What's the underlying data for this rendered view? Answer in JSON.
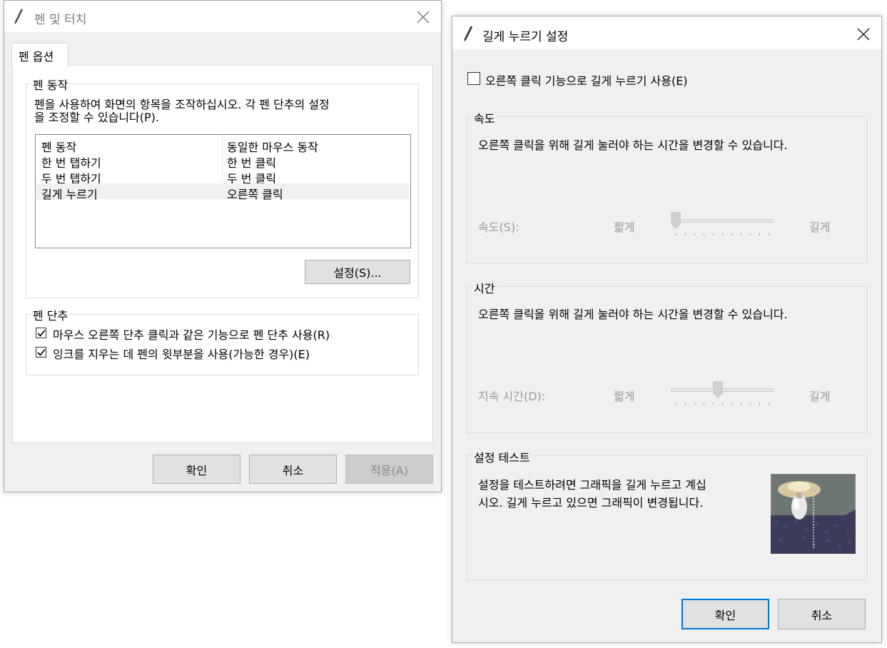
{
  "pen_touch": {
    "title": "펜 및 터치",
    "tab": "펜 옵션",
    "pen_actions_group": "펜 동작",
    "description_line1": "펜을 사용하여 화면의 항목을 조작하십시오. 각 펜 단추의 설정",
    "description_line2": "을 조정할 수 있습니다(P).",
    "table": {
      "headers": [
        "펜 동작",
        "동일한 마우스 동작"
      ],
      "rows": [
        [
          "한 번 탭하기",
          "한 번 클릭"
        ],
        [
          "두 번 탭하기",
          "두 번 클릭"
        ],
        [
          "길게 누르기",
          "오른쪽 클릭"
        ]
      ],
      "selected_row": 2
    },
    "settings_button": "설정(S)...",
    "pen_buttons_group": "펜 단추",
    "checkbox1": {
      "label": "마우스 오른쪽 단추 클릭과 같은 기능으로 펜 단추 사용(R)",
      "checked": true
    },
    "checkbox2": {
      "label": "잉크를 지우는 데 펜의 윗부분을 사용(가능한 경우)(E)",
      "checked": true
    },
    "ok": "확인",
    "cancel": "취소",
    "apply": "적용(A)"
  },
  "press_hold": {
    "title": "길게 누르기 설정",
    "enable_checkbox": {
      "label": "오른쪽 클릭 기능으로 길게 누르기 사용(E)",
      "checked": false
    },
    "speed_group": {
      "label": "속도",
      "description": "오른쪽 클릭을 위해 길게 눌러야 하는 시간을 변경할 수 있습니다.",
      "slider_label": "속도(S):",
      "min_label": "짧게",
      "max_label": "길게",
      "value": 0.0
    },
    "time_group": {
      "label": "시간",
      "description": "오른쪽 클릭을 위해 길게 눌러야 하는 시간을 변경할 수 있습니다.",
      "slider_label": "지속 시간(D):",
      "min_label": "짧게",
      "max_label": "길게",
      "value": 0.45
    },
    "test_group": {
      "label": "설정 테스트",
      "description_line1": "설정을 테스트하려면 그래픽을 길게 누르고 계십",
      "description_line2": "시오. 길게 누르고 있으면 그래픽이 변경됩니다."
    },
    "ok": "확인",
    "cancel": "취소"
  },
  "colors": {
    "accent": "#0078d7",
    "selected_row": "#f0f0f0",
    "disabled_text": "#9a9a9a"
  }
}
